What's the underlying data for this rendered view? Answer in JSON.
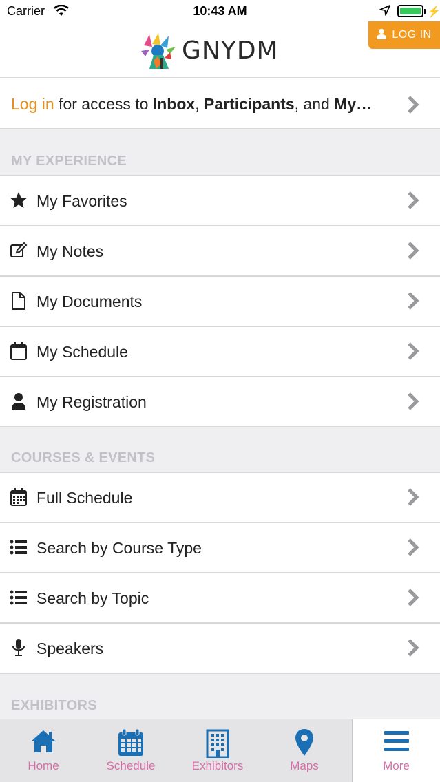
{
  "status_bar": {
    "carrier": "Carrier",
    "time": "10:43 AM"
  },
  "header": {
    "brand": "GNYDM",
    "login_button": "LOG IN"
  },
  "banner": {
    "login_link": "Log in",
    "text_1": " for access to ",
    "inbox": "Inbox",
    "comma": ", ",
    "participants": "Participants",
    "and": ", and ",
    "my": "My…"
  },
  "sections": {
    "my_experience": {
      "title": "MY EXPERIENCE",
      "items": [
        {
          "label": "My Favorites",
          "icon": "star-icon"
        },
        {
          "label": "My Notes",
          "icon": "edit-icon"
        },
        {
          "label": "My Documents",
          "icon": "document-icon"
        },
        {
          "label": "My Schedule",
          "icon": "calendar-icon"
        },
        {
          "label": "My Registration",
          "icon": "user-icon"
        }
      ]
    },
    "courses_events": {
      "title": "COURSES & EVENTS",
      "items": [
        {
          "label": "Full Schedule",
          "icon": "calendar-grid-icon"
        },
        {
          "label": "Search by Course Type",
          "icon": "list-icon"
        },
        {
          "label": "Search by Topic",
          "icon": "list-icon"
        },
        {
          "label": "Speakers",
          "icon": "microphone-icon"
        }
      ]
    },
    "exhibitors": {
      "title": "EXHIBITORS"
    }
  },
  "tabbar": {
    "active": "More",
    "tabs": [
      {
        "label": "Home",
        "icon": "home-icon"
      },
      {
        "label": "Schedule",
        "icon": "calendar-icon"
      },
      {
        "label": "Exhibitors",
        "icon": "building-icon"
      },
      {
        "label": "Maps",
        "icon": "map-pin-icon"
      },
      {
        "label": "More",
        "icon": "menu-icon"
      }
    ]
  },
  "colors": {
    "accent_orange": "#f29a1f",
    "tab_icon_blue": "#1a6fb5",
    "tab_label_pink": "#d86ca8",
    "section_label_gray": "#c2c2c6"
  }
}
